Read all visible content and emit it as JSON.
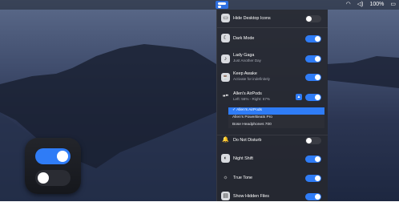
{
  "menubar": {
    "battery": "100%",
    "icons": [
      "wifi-icon",
      "volume-icon",
      "battery-icon",
      "toggle-app-icon"
    ]
  },
  "menu": {
    "items": [
      {
        "label": "Hide Desktop Icons",
        "on": false,
        "icon": "desktop-icon"
      },
      {
        "label": "Dark Mode",
        "on": true,
        "icon": "moon-icon"
      },
      {
        "label": "Lady Gaga",
        "sub": "Just Another Day",
        "on": true,
        "icon": "music-icon"
      },
      {
        "label": "Keep Awake",
        "sub": "Activate for indefinitely",
        "on": true,
        "icon": "coffee-icon"
      },
      {
        "label": "Allen's AirPods",
        "sub": "Left: 56% - Right: 67%",
        "on": true,
        "icon": "airpods-icon"
      },
      {
        "label": "Do Not Disturb",
        "on": false,
        "icon": "bell-icon"
      },
      {
        "label": "Night Shift",
        "on": true,
        "icon": "night-shift-icon"
      },
      {
        "label": "True Tone",
        "on": true,
        "icon": "sun-icon"
      },
      {
        "label": "Show Hidden Files",
        "on": true,
        "icon": "file-icon"
      }
    ],
    "dropdown": [
      {
        "label": "✓ Allen's AirPods",
        "selected": true
      },
      {
        "label": "Allen's PowerBeats Pro",
        "selected": false
      },
      {
        "label": "Bose Headphones 700",
        "selected": false
      }
    ]
  }
}
